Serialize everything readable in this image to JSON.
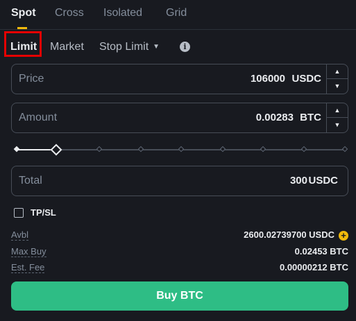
{
  "tabs": [
    {
      "label": "Spot",
      "active": true
    },
    {
      "label": "Cross",
      "active": false
    },
    {
      "label": "Isolated",
      "active": false
    },
    {
      "label": "Grid",
      "active": false
    }
  ],
  "order_types": {
    "limit": "Limit",
    "market": "Market",
    "stop_limit": "Stop Limit",
    "caret": "▼",
    "info_icon": "i"
  },
  "price": {
    "label": "Price",
    "value": "106000",
    "unit": "USDC"
  },
  "amount": {
    "label": "Amount",
    "value": "0.00283",
    "unit": "BTC"
  },
  "slider": {
    "percent": 12
  },
  "total": {
    "label": "Total",
    "value": "300",
    "unit": "USDC"
  },
  "tpsl": {
    "label": "TP/SL",
    "checked": false
  },
  "info": {
    "avbl_label": "Avbl",
    "avbl_value": "2600.02739700 USDC",
    "maxbuy_label": "Max Buy",
    "maxbuy_value": "0.02453 BTC",
    "fee_label": "Est. Fee",
    "fee_value": "0.00000212 BTC"
  },
  "buy_button": "Buy BTC",
  "colors": {
    "accent": "#f0b90b",
    "buy": "#2ebd85",
    "highlight": "#e60000"
  }
}
